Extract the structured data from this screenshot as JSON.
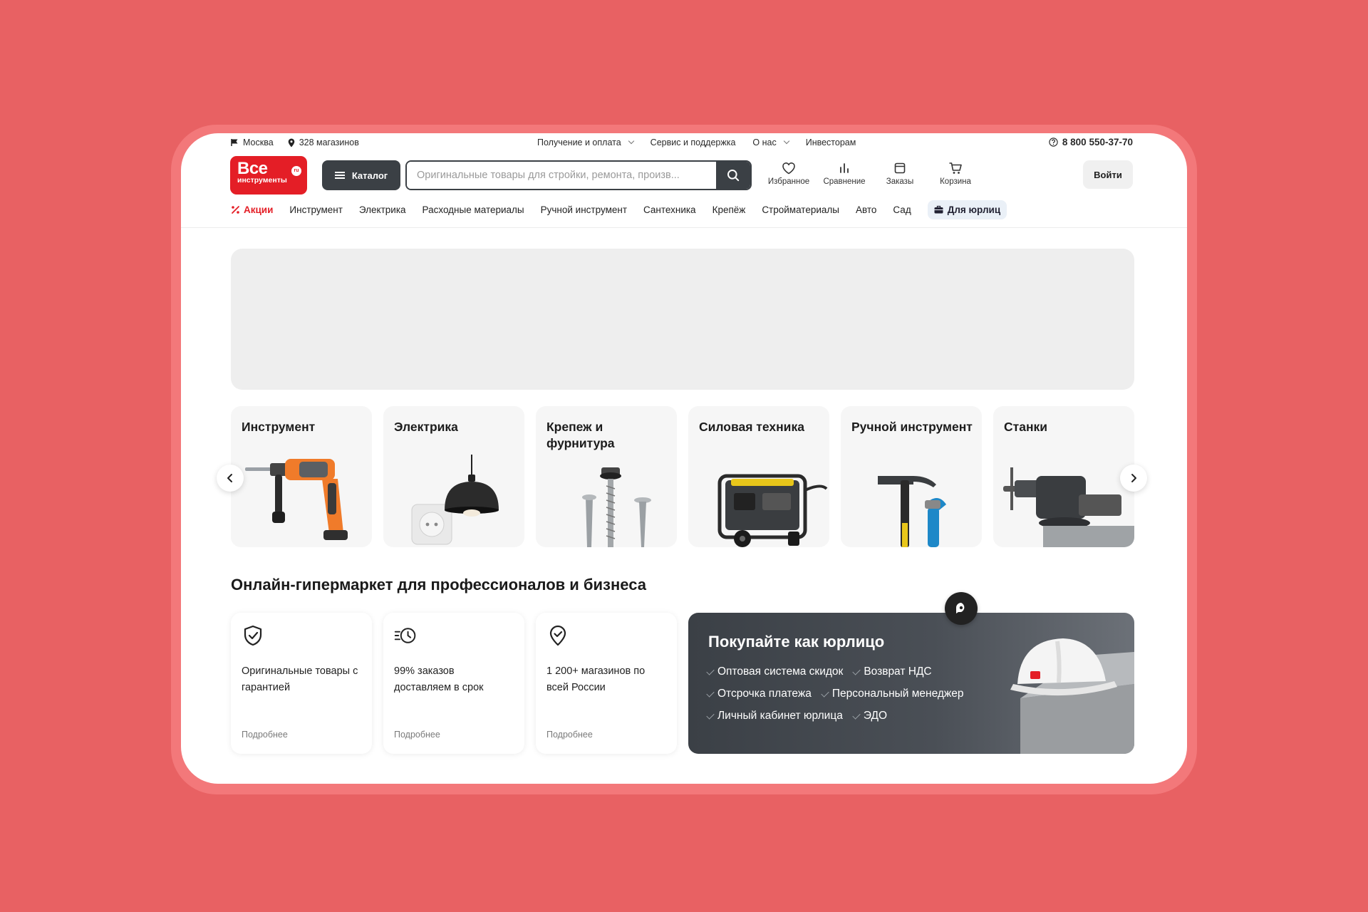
{
  "topbar": {
    "city": "Москва",
    "stores": "328 магазинов",
    "links": [
      "Получение и оплата",
      "Сервис и поддержка",
      "О нас",
      "Инвесторам"
    ],
    "phone": "8 800 550-37-70"
  },
  "header": {
    "logo_big": "Все",
    "logo_small": "инструменты",
    "logo_badge": "ru",
    "catalog": "Каталог",
    "search_placeholder": "Оригинальные товары для стройки, ремонта, произв...",
    "icons": [
      {
        "label": "Избранное",
        "icon": "heart-icon"
      },
      {
        "label": "Сравнение",
        "icon": "compare-icon"
      },
      {
        "label": "Заказы",
        "icon": "orders-icon"
      },
      {
        "label": "Корзина",
        "icon": "cart-icon"
      }
    ],
    "login": "Войти"
  },
  "nav": {
    "promo": "Акции",
    "items": [
      "Инструмент",
      "Электрика",
      "Расходные материалы",
      "Ручной инструмент",
      "Сантехника",
      "Крепёж",
      "Стройматериалы",
      "Авто",
      "Сад"
    ],
    "business": "Для юрлиц"
  },
  "categories": [
    {
      "title": "Инструмент"
    },
    {
      "title": "Электрика"
    },
    {
      "title": "Крепеж и фурнитура"
    },
    {
      "title": "Силовая техника"
    },
    {
      "title": "Ручной инструмент"
    },
    {
      "title": "Станки"
    }
  ],
  "section": {
    "title": "Онлайн-гипермаркет для профессионалов и бизнеса",
    "features": [
      {
        "text": "Оригинальные товары с гарантией",
        "more": "Подробнее",
        "icon": "shield-check-icon"
      },
      {
        "text": "99% заказов доставляем в срок",
        "more": "Подробнее",
        "icon": "fast-clock-icon"
      },
      {
        "text": "1 200+ магазинов по всей России",
        "more": "Подробнее",
        "icon": "map-pin-check-icon"
      }
    ],
    "business_card": {
      "title": "Покупайте как юрлицо",
      "row1": [
        "Оптовая система скидок",
        "Возврат НДС"
      ],
      "row2": [
        "Отсрочка платежа",
        "Персональный менеджер"
      ],
      "row3": [
        "Личный кабинет юрлица",
        "ЭДО"
      ]
    }
  },
  "colors": {
    "brand": "#e41e26",
    "dark": "#3b4045",
    "background": "#e86163"
  }
}
